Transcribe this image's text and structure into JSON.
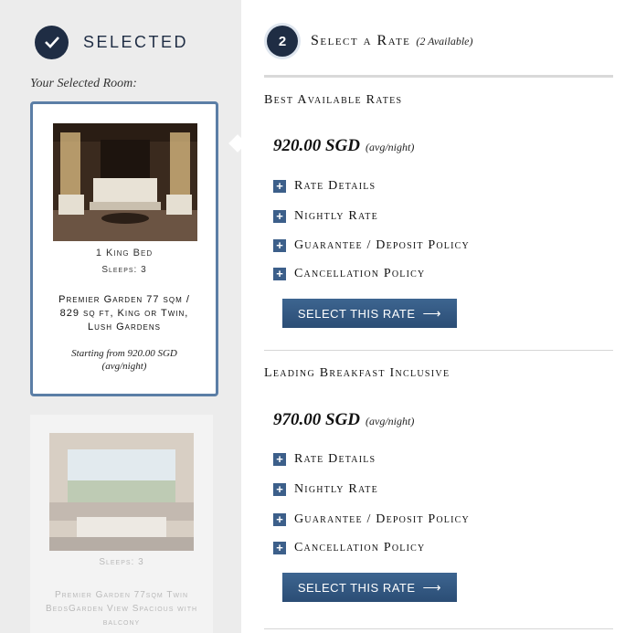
{
  "left": {
    "header": "SELECTED",
    "your_room_label": "Your Selected Room:",
    "selected_room": {
      "bed": "1 King Bed",
      "sleeps": "Sleeps: 3",
      "name": "Premier Garden 77 sqm / 829 sq ft, King or Twin, Lush Gardens",
      "price": "Starting from 920.00 SGD (avg/night)"
    },
    "other_room": {
      "sleeps": "Sleeps: 3",
      "name": "Premier Garden 77sqm Twin BedsGarden View Spacious with balcony"
    }
  },
  "right": {
    "step_number": "2",
    "step_title": "Select a Rate",
    "step_sub": "(2 Available)",
    "rates": [
      {
        "title": "Best Available Rates",
        "price": "920.00 SGD",
        "unit": "(avg/night)",
        "items": [
          "Rate Details",
          "Nightly Rate",
          "Guarantee / Deposit Policy",
          "Cancellation Policy"
        ],
        "button": "SELECT THIS RATE"
      },
      {
        "title": "Leading Breakfast Inclusive",
        "price": "970.00 SGD",
        "unit": "(avg/night)",
        "items": [
          "Rate Details",
          "Nightly Rate",
          "Guarantee / Deposit Policy",
          "Cancellation Policy"
        ],
        "button": "SELECT THIS RATE"
      }
    ]
  },
  "icons": {
    "check": "check-icon",
    "plus": "plus-icon",
    "arrow": "arrow-right-icon"
  },
  "colors": {
    "navy": "#1f2d44",
    "accent_blue": "#3c5f8a",
    "card_border": "#5b7ea6"
  }
}
